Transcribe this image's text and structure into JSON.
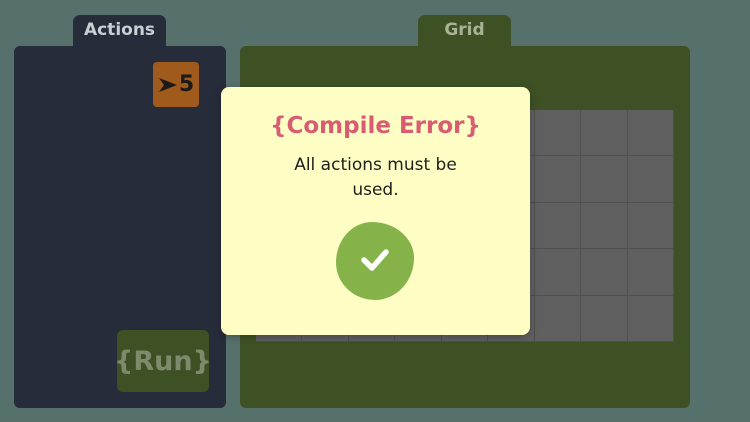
{
  "tabs": {
    "actions_label": "Actions",
    "grid_label": "Grid"
  },
  "actions": {
    "cards": [
      {
        "icon": "arrow-right-icon",
        "count": "5"
      }
    ],
    "run_label": "{Run}"
  },
  "grid": {
    "columns": 9,
    "rows": 5
  },
  "dialog": {
    "title": "{Compile Error}",
    "message": "All actions must be used.",
    "confirm_icon": "checkmark-icon"
  },
  "colors": {
    "background": "#56706b",
    "actions_panel": "#262c3a",
    "grid_panel": "#3e5125",
    "action_card": "#a05b1c",
    "grid_cell": "#5f5f5f",
    "dialog_bg": "#fefec4",
    "dialog_title": "#d85c72",
    "confirm_button": "#86b24a"
  }
}
